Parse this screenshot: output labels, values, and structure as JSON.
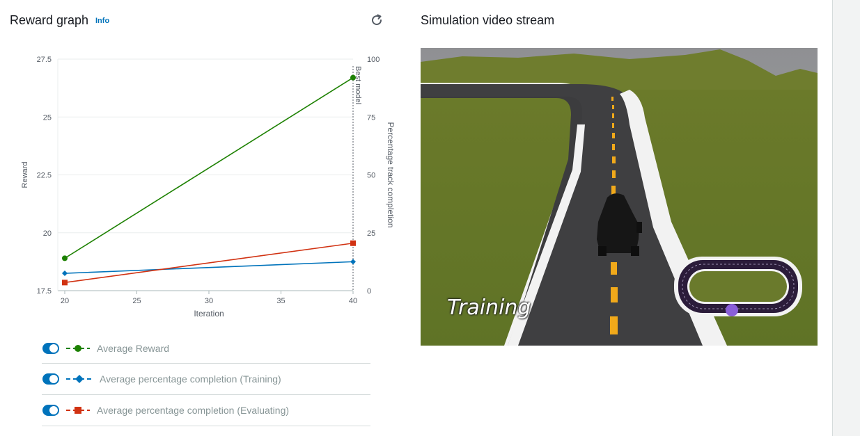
{
  "reward_panel": {
    "title": "Reward graph",
    "info_label": "Info"
  },
  "video_panel": {
    "title": "Simulation video stream",
    "overlay_label": "Training"
  },
  "legend": [
    {
      "label": "Average Reward",
      "color": "#1d8102",
      "marker": "circle",
      "enabled": true
    },
    {
      "label": "Average percentage completion (Training)",
      "color": "#0073bb",
      "marker": "diamond",
      "enabled": true
    },
    {
      "label": "Average percentage completion (Evaluating)",
      "color": "#d13212",
      "marker": "square",
      "enabled": true
    }
  ],
  "chart_data": {
    "type": "line",
    "xlabel": "Iteration",
    "ylabel": "Reward",
    "y2label": "Percentage track completion",
    "xlim": [
      20,
      40
    ],
    "ylim": [
      17.5,
      27.5
    ],
    "y2lim": [
      0,
      100
    ],
    "xticks": [
      20,
      25,
      30,
      35,
      40
    ],
    "yticks": [
      17.5,
      20,
      22.5,
      25,
      27.5
    ],
    "yticklabels": [
      "17.5",
      "20",
      "22.5",
      "25",
      "27.5"
    ],
    "y2ticks": [
      0,
      25,
      50,
      75,
      100
    ],
    "annotation": {
      "label": "Best model",
      "x": 40
    },
    "grid": true,
    "series": [
      {
        "name": "Average Reward",
        "axis": "left",
        "color": "#1d8102",
        "marker": "circle",
        "points": [
          [
            20,
            18.9
          ],
          [
            40,
            26.7
          ]
        ]
      },
      {
        "name": "Average percentage completion (Training)",
        "axis": "right",
        "color": "#0073bb",
        "marker": "diamond",
        "points": [
          [
            20,
            7.5
          ],
          [
            40,
            12.5
          ]
        ]
      },
      {
        "name": "Average percentage completion (Evaluating)",
        "axis": "right",
        "color": "#d13212",
        "marker": "square",
        "points": [
          [
            20,
            3.5
          ],
          [
            40,
            20.5
          ]
        ]
      }
    ]
  }
}
